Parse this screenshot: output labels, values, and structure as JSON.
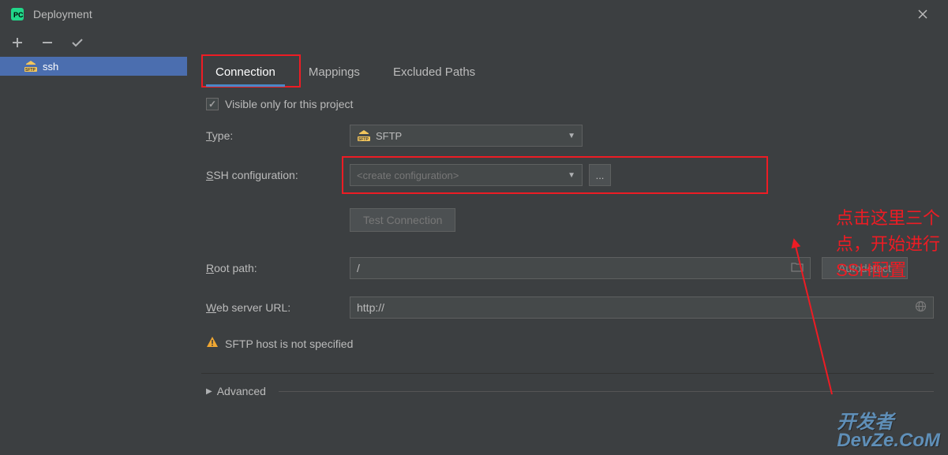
{
  "window": {
    "title": "Deployment"
  },
  "sidebar": {
    "items": [
      {
        "label": "ssh",
        "selected": true
      }
    ]
  },
  "tabs": [
    {
      "label": "Connection",
      "active": true
    },
    {
      "label": "Mappings",
      "active": false
    },
    {
      "label": "Excluded Paths",
      "active": false
    }
  ],
  "form": {
    "visible_only_label": "Visible only for this project",
    "visible_only_checked": true,
    "type_label": "Type:",
    "type_underline": "T",
    "type_value": "SFTP",
    "ssh_config_label": "SSH configuration:",
    "ssh_config_underline": "S",
    "ssh_config_placeholder": "<create configuration>",
    "test_connection_label": "Test Connection",
    "root_path_label": "Root path:",
    "root_path_underline": "R",
    "root_path_value": "/",
    "autodetect_label": "Autodetect",
    "web_url_label": "Web server URL:",
    "web_url_underline": "W",
    "web_url_value": "http://",
    "warning_text": "SFTP host is not specified",
    "advanced_label": "Advanced"
  },
  "annotation": {
    "line1": "点击这里三个点，开始进行",
    "line2": "SSH配置"
  },
  "watermark": {
    "line1": "开发者",
    "line2": "DevZe.CoM"
  }
}
